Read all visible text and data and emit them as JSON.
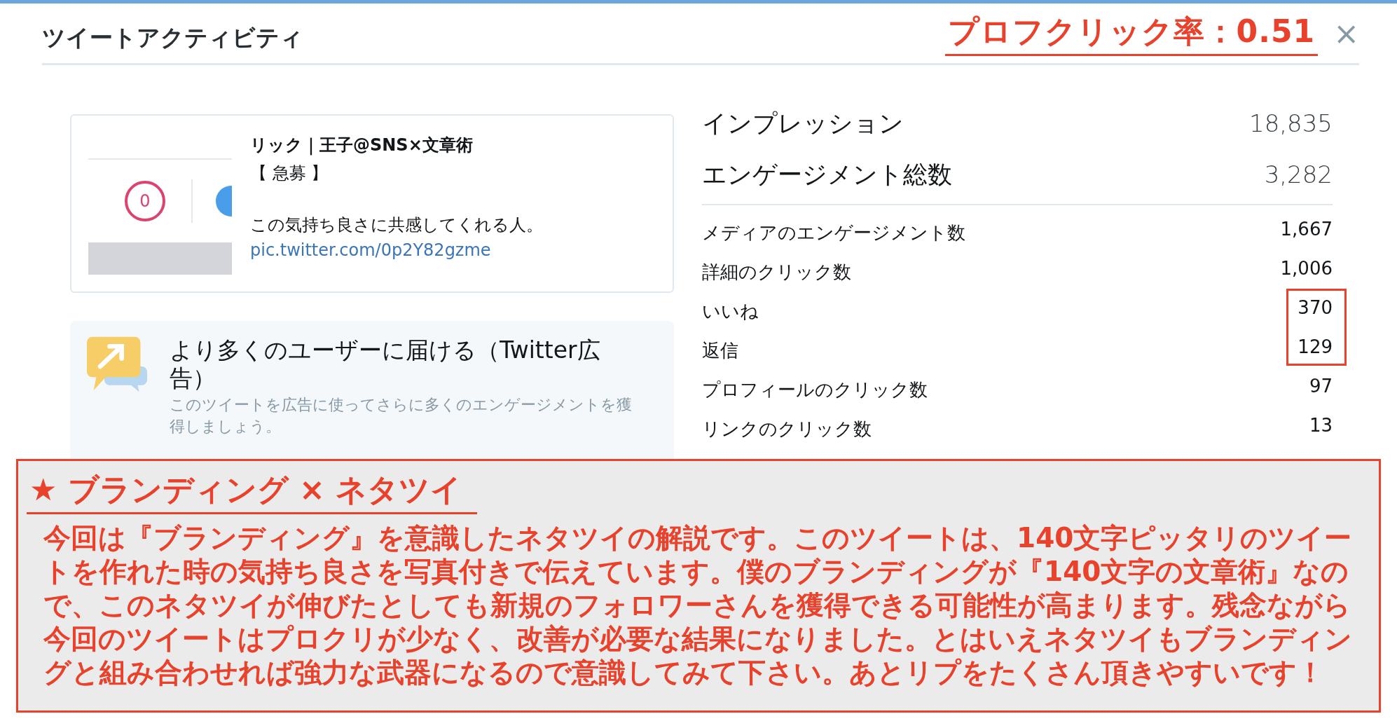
{
  "header": {
    "title": "ツイートアクティビティ",
    "annotation": "プロフクリック率：0.51",
    "close": "×"
  },
  "tweet": {
    "thumbnail": {
      "badge": "0"
    },
    "author": "リック｜王子@SNS×文章術",
    "tag": "【 急募 】",
    "text": "この気持ち良さに共感してくれる人。",
    "link": "pic.twitter.com/0p2Y82gzme"
  },
  "promo": {
    "title": "より多くのユーザーに届ける（Twitter広告）",
    "description": "このツイートを広告に使ってさらに多くのエンゲージメントを獲得しましょう。"
  },
  "metrics": {
    "totals": [
      {
        "label": "インプレッション",
        "value": "18,835"
      },
      {
        "label": "エンゲージメント総数",
        "value": "3,282"
      }
    ],
    "details": [
      {
        "label": "メディアのエンゲージメント数",
        "value": "1,667",
        "highlighted": false
      },
      {
        "label": "詳細のクリック数",
        "value": "1,006",
        "highlighted": false
      },
      {
        "label": "いいね",
        "value": "370",
        "highlighted": true
      },
      {
        "label": "返信",
        "value": "129",
        "highlighted": true
      },
      {
        "label": "プロフィールのクリック数",
        "value": "97",
        "highlighted": false
      },
      {
        "label": "リンクのクリック数",
        "value": "13",
        "highlighted": false
      }
    ]
  },
  "note": {
    "heading": "★ ブランディング × ネタツイ",
    "body": "今回は『ブランディング』を意識したネタツイの解説です。このツイートは、140文字ピッタリのツイートを作れた時の気持ち良さを写真付きで伝えています。僕のブランディングが『140文字の文章術』なので、このネタツイが伸びたとしても新規のフォロワーさんを獲得できる可能性が高まります。残念ながら今回のツイートはプロクリが少なく、改善が必要な結果になりました。とはいえネタツイもブランディングと組み合わせれば強力な武器になるので意識してみて下さい。あとリプをたくさん頂きやすいです！"
  }
}
